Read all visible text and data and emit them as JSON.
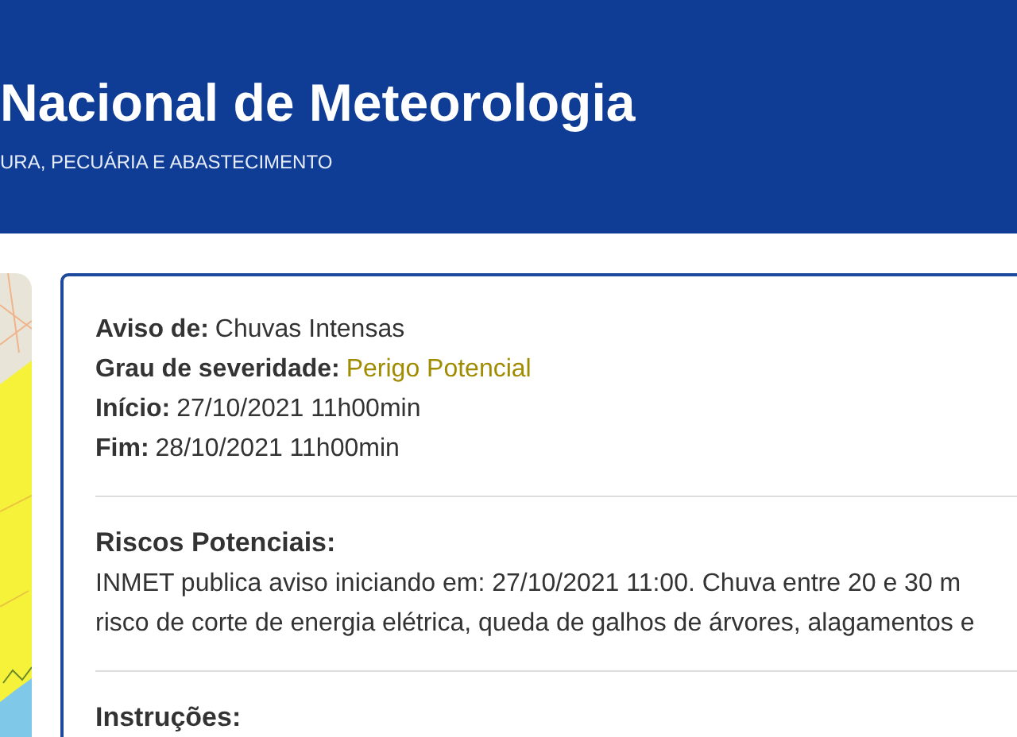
{
  "header": {
    "title": "Nacional de Meteorologia",
    "subtitle": "URA, PECUÁRIA E ABASTECIMENTO"
  },
  "alert": {
    "fields": [
      {
        "label": "Aviso de:",
        "value": "Chuvas Intensas"
      },
      {
        "label": "Grau de severidade:",
        "value": "Perigo Potencial",
        "color": "#a08c00"
      },
      {
        "label": "Início:",
        "value": "27/10/2021 11h00min"
      },
      {
        "label": "Fim:",
        "value": "28/10/2021 11h00min"
      }
    ],
    "sections": [
      {
        "heading": "Riscos Potenciais:",
        "lines": [
          "INMET publica aviso iniciando em: 27/10/2021 11:00. Chuva entre 20 e 30 m",
          "risco de corte de energia elétrica, queda de galhos de árvores, alagamentos e"
        ]
      },
      {
        "heading": "Instruções:"
      }
    ]
  }
}
